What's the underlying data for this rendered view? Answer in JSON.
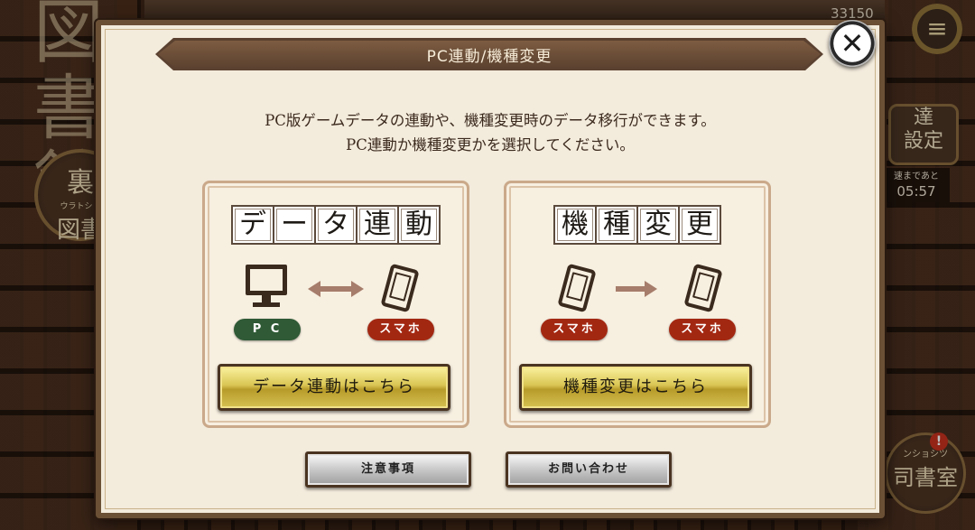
{
  "background": {
    "kanji_big": "図書館",
    "counter": "33150",
    "left_circle": {
      "top": "裏",
      "small": "ウラトショ",
      "bottom": "図書"
    },
    "right_panel": "達\n設定",
    "right_timer_label": "速まであと",
    "right_timer_value": "05:57",
    "right_bottom_small": "ンショシツ",
    "right_bottom_text": "司書室",
    "alert": "!",
    "menu_icon": "≡"
  },
  "dialog": {
    "title": "PC連動/機種変更",
    "close_label": "✕",
    "description_line1": "PC版ゲームデータの連動や、機種変更時のデータ移行ができます。",
    "description_line2": "PC連動か機種変更かを選択してください。",
    "cards": [
      {
        "tiles": [
          "デ",
          "ー",
          "タ",
          "連",
          "動"
        ],
        "from_label": "P C",
        "to_label": "スマホ",
        "button_label": "データ連動はこちら"
      },
      {
        "tiles": [
          "機",
          "種",
          "変",
          "更"
        ],
        "from_label": "スマホ",
        "to_label": "スマホ",
        "button_label": "機種変更はこちら"
      }
    ],
    "notes_button": "注意事項",
    "contact_button": "お問い合わせ"
  },
  "colors": {
    "pill_green": "#2f5a35",
    "pill_red": "#a32812",
    "title_band": "#5a4130",
    "gold_button": "#d9c553"
  }
}
